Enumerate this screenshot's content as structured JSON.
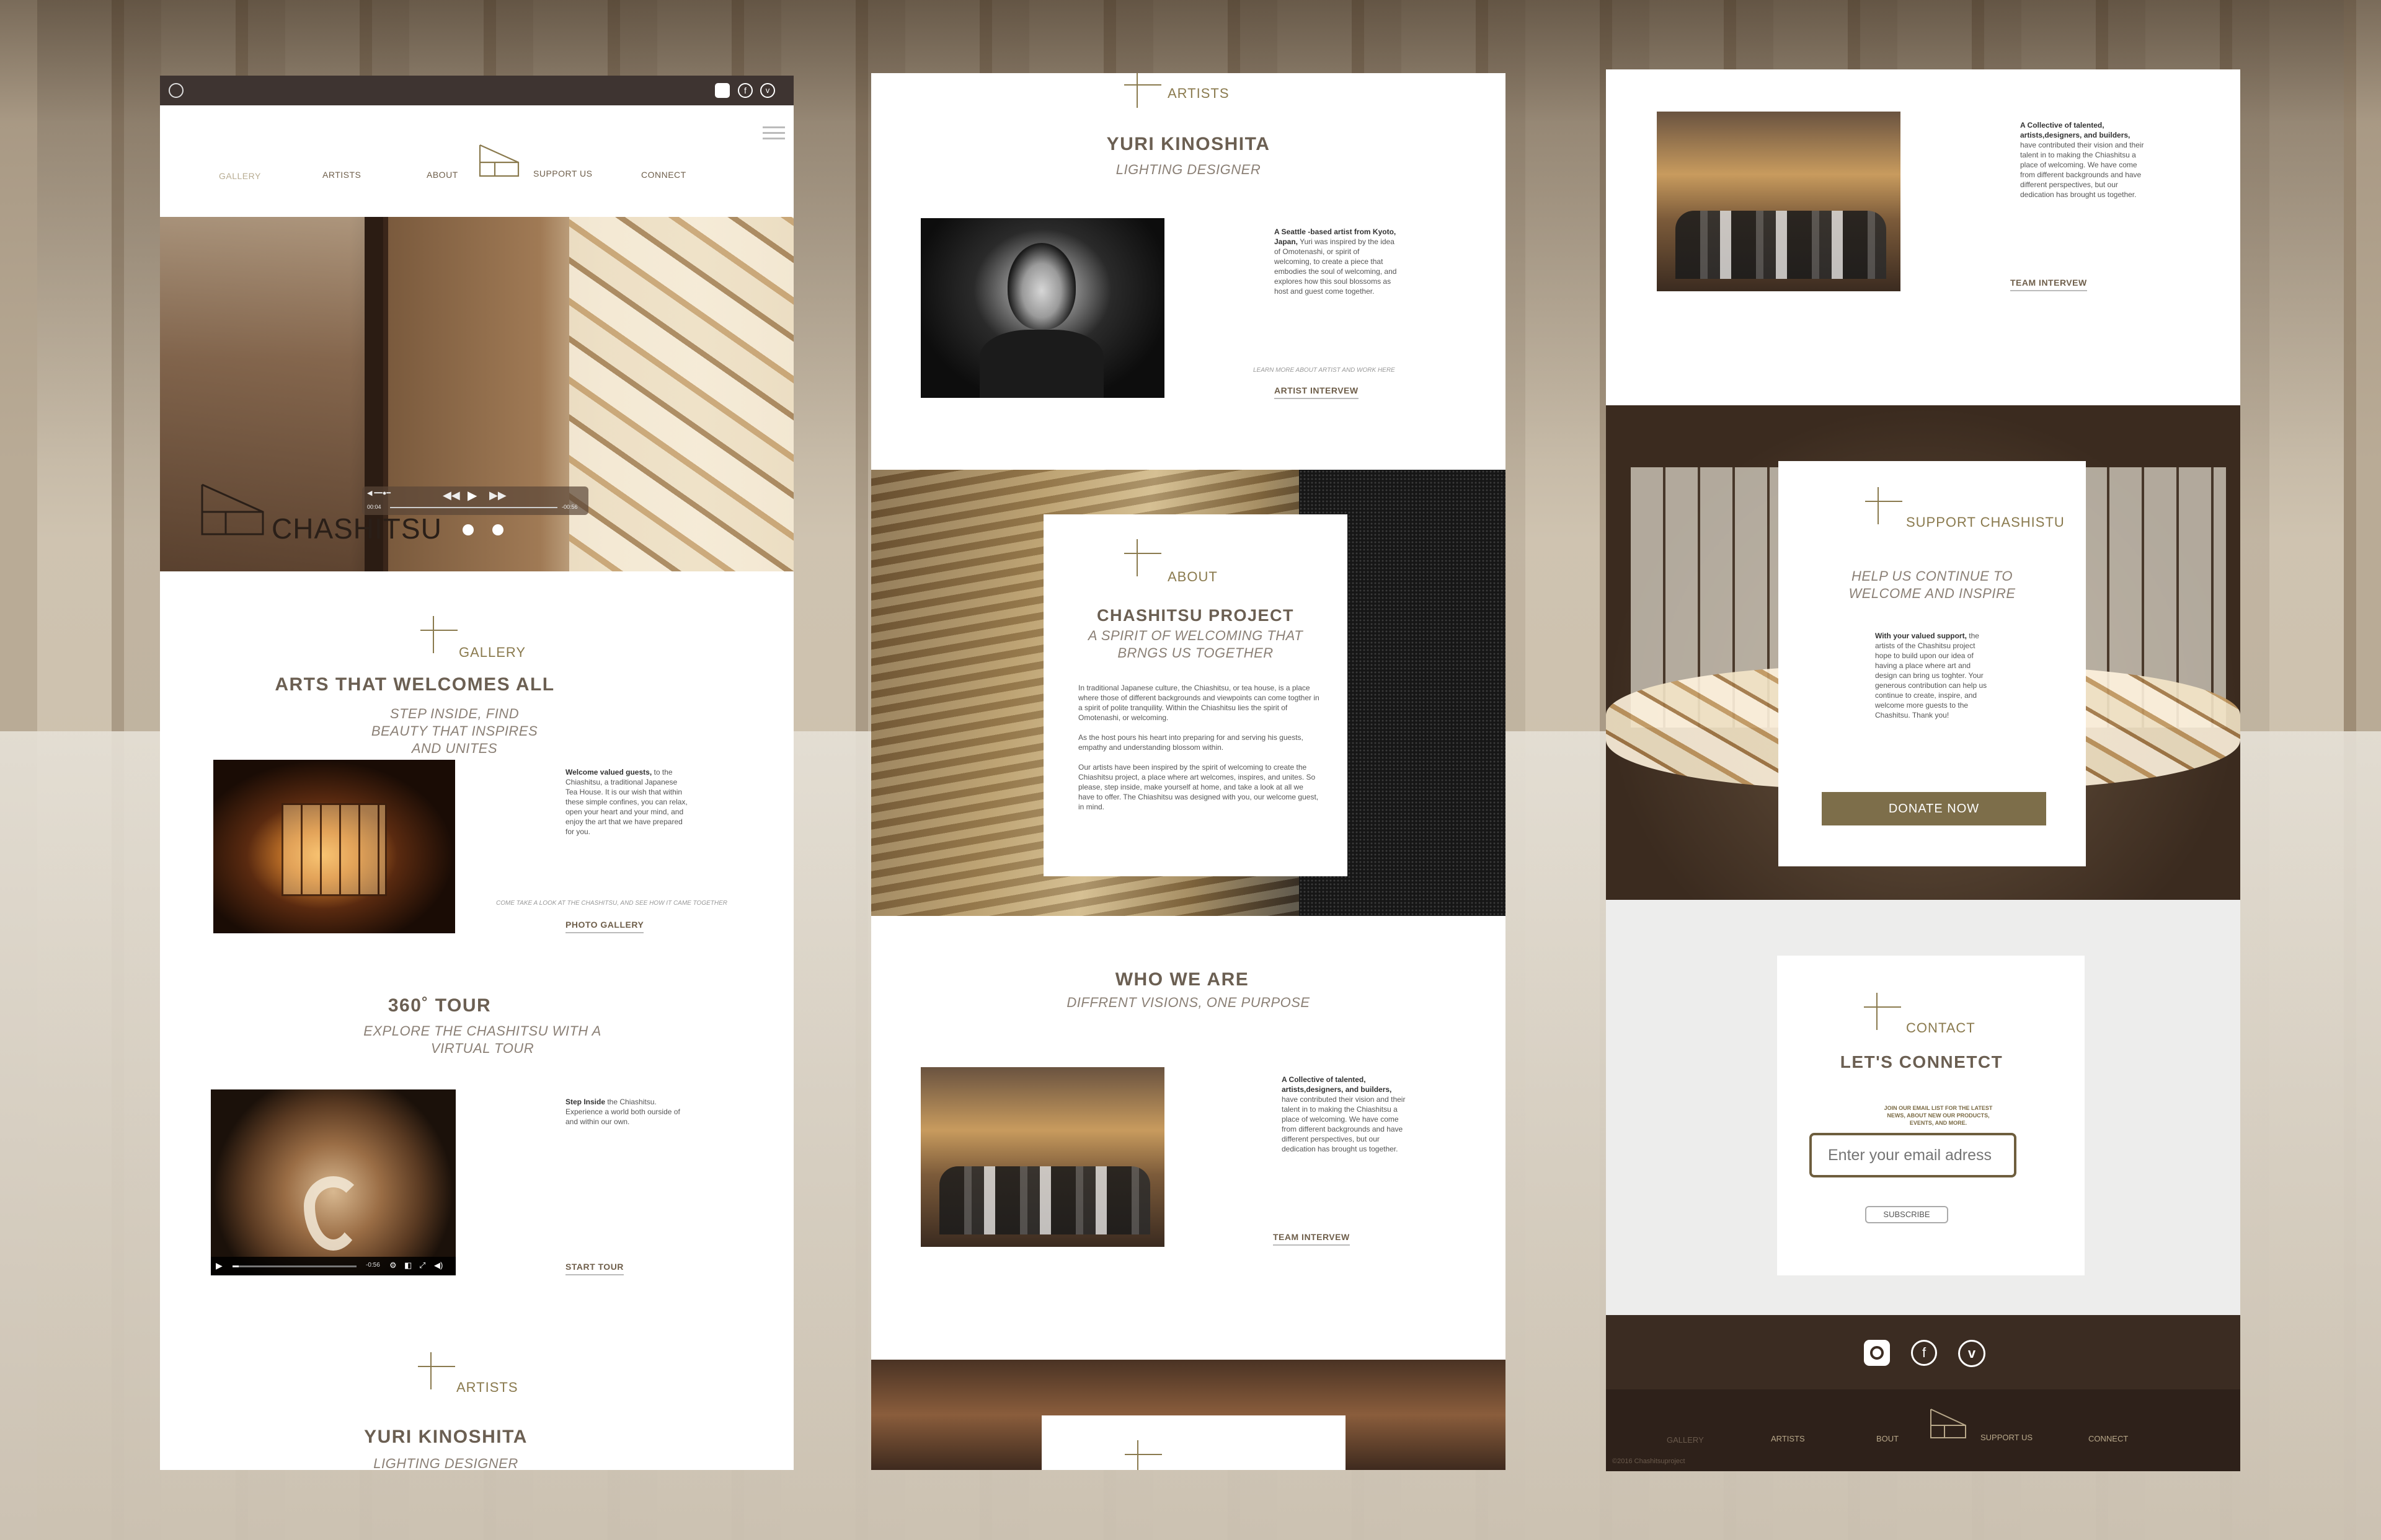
{
  "panel1": {
    "nav": [
      "GALLERY",
      "ARTISTS",
      "ABOUT",
      "SUPPORT US",
      "CONNECT"
    ],
    "hero_brand": "CHASHITSU",
    "video_time_left": "00:04",
    "video_time_right": "-00:56",
    "gallery_label": "GALLERY",
    "gallery_title": "ARTS THAT WELCOMES ALL",
    "gallery_sub": "STEP INSIDE, FIND BEAUTY THAT INSPIRES AND UNITES",
    "gallery_text_bold": "Welcome valued guests,",
    "gallery_text": "to the Chiashitsu, a traditional Japanese Tea House. It is our wish that within these simple confines, you can relax, open your heart and your mind, and enjoy the art that we have prepared for you.",
    "gallery_note": "COME TAKE A LOOK AT THE CHASHITSU, AND SEE HOW IT CAME TOGETHER",
    "gallery_link": "PHOTO GALLERY",
    "tour_title": "360˚ TOUR",
    "tour_sub": "EXPLORE THE CHASHITSU WITH A VIRTUAL TOUR",
    "tour_text_bold": "Step Inside",
    "tour_text": " the Chiashitsu. Experience a world both ourside of and within our own.",
    "tour_time": "-0:56",
    "tour_link": "START TOUR",
    "artists_label": "ARTISTS",
    "artist_name": "YURI KINOSHITA",
    "artist_role": "LIGHTING DESIGNER"
  },
  "panel2": {
    "artists_label": "ARTISTS",
    "artist_name": "YURI KINOSHITA",
    "artist_role": "LIGHTING DESIGNER",
    "artist_text_bold": "A Seattle -based artist from Kyoto, Japan,",
    "artist_text": " Yuri was inspired by the idea of Omotenashi, or spirit of welcoming, to create a piece that embodies the soul of welcoming, and explores how this soul blossoms as host and guest come together.",
    "artist_note": "LEARN MORE ABOUT ARTIST AND WORK HERE",
    "artist_link": "ARTIST INTERVEW",
    "about_label": "ABOUT",
    "about_title": "CHASHITSU PROJECT",
    "about_sub": "A SPIRIT OF WELCOMING THAT BRNGS US TOGETHER",
    "about_p1": "In traditional Japanese culture, the Chiashitsu, or tea house, is a place where those of different backgrounds and viewpoints can come togther in a spirit of polite tranquility. Within the Chiashitsu lies the spirit of Omotenashi, or welcoming.",
    "about_p2": "As the host pours his heart into preparing for and serving his guests, empathy and understanding blossom within.",
    "about_p3": "Our artists have been inspired by the spirit of welcoming to create the Chiashitsu project, a place where art welcomes, inspires, and unites. So please, step inside, make yourself at home, and take a look at all we have to offer. The Chiashitsu was designed with you, our welcome guest, in mind.",
    "who_title": "WHO WE ARE",
    "who_sub": "DIFFRENT VISIONS, ONE PURPOSE",
    "team_text_bold": "A Collective of talented, artists,designers, and builders,",
    "team_text": " have contributed their vision and their talent in to making the Chiashitsu a place of welcoming. We have come from different backgrounds and have different perspectives, but our dedication has brought us together.",
    "team_link": "TEAM INTERVEW"
  },
  "panel3": {
    "team_text_bold": "A Collective of talented, artists,designers, and builders,",
    "team_text": " have contributed their vision and their talent in to making the Chiashitsu a place of welcoming. We have come from different backgrounds and have different perspectives, but our dedication has brought us together.",
    "team_link": "TEAM INTERVEW",
    "support_label": "SUPPORT CHASHISTU",
    "support_sub": "HELP US CONTINUE TO WELCOME AND INSPIRE",
    "support_text_bold": "With your valued support,",
    "support_text": " the artists of the Chashitsu project hope to build upon our idea of having a place where art and design can bring us toghter. Your generous contribution can help us continue to create, inspire, and welcome more guests to the Chashitsu. Thank you!",
    "donate": "DONATE NOW",
    "contact_label": "CONTACT",
    "contact_title": "LET'S CONNETCT",
    "contact_note": "JOIN OUR EMAIL LIST FOR THE LATEST NEWS, ABOUT NEW OUR PRODUCTS, EVENTS, AND MORE.",
    "email_placeholder": "Enter your email adress",
    "subscribe": "SUBSCRIBE",
    "footer_nav": [
      "GALLERY",
      "ARTISTS",
      "BOUT",
      "SUPPORT US",
      "CONNECT"
    ],
    "copyright": "©2016 Chashitsuproject"
  },
  "colors": {
    "accent": "#8a7a4e",
    "dark_brown": "#3b2c22",
    "donate": "#7d6e4a"
  }
}
